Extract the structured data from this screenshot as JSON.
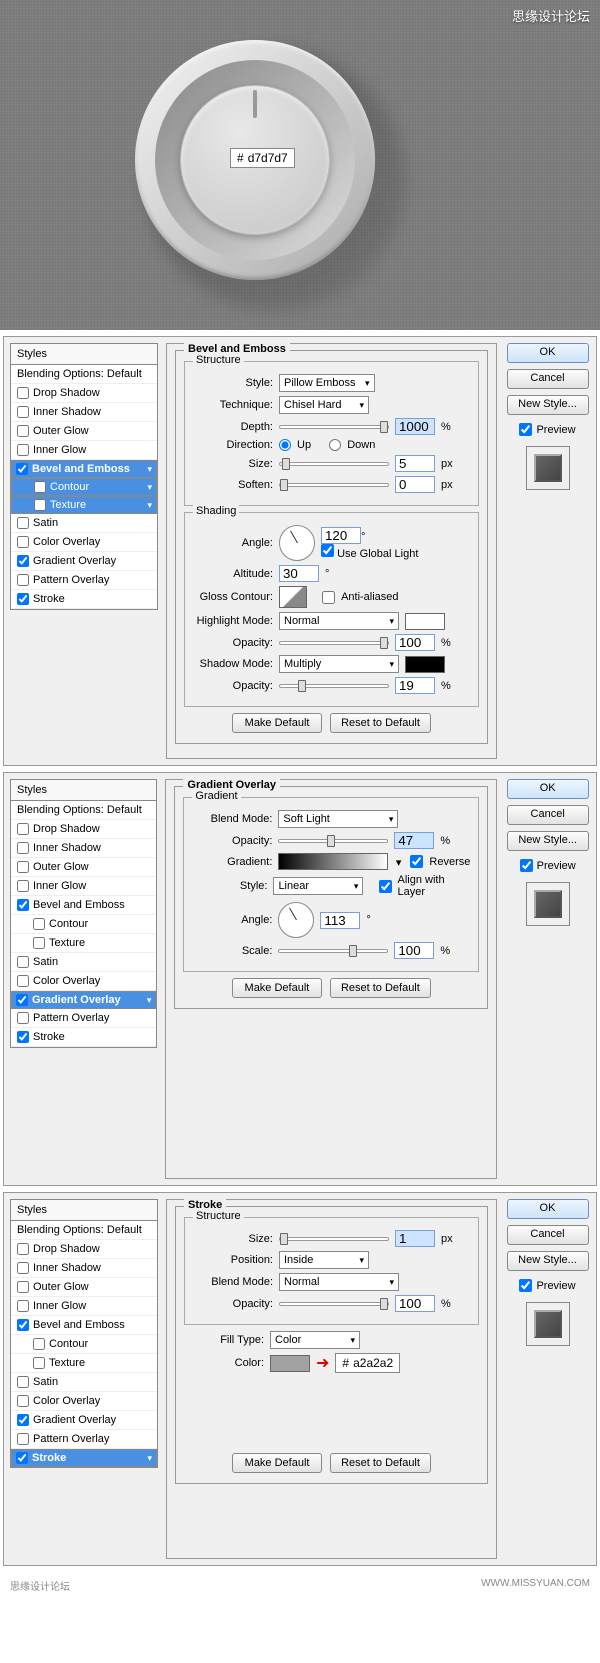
{
  "watermark_top": "思缘设计论坛",
  "hero_hex": "d7d7d7",
  "styles_header": "Styles",
  "blending_label": "Blending Options: Default",
  "common_style_items": [
    {
      "label": "Drop Shadow",
      "checked": false
    },
    {
      "label": "Inner Shadow",
      "checked": false
    },
    {
      "label": "Outer Glow",
      "checked": false
    },
    {
      "label": "Inner Glow",
      "checked": false
    },
    {
      "label": "Bevel and Emboss",
      "checked": true
    },
    {
      "label": "Contour",
      "checked": false,
      "indent": true
    },
    {
      "label": "Texture",
      "checked": false,
      "indent": true
    },
    {
      "label": "Satin",
      "checked": false
    },
    {
      "label": "Color Overlay",
      "checked": false
    },
    {
      "label": "Gradient Overlay",
      "checked": true
    },
    {
      "label": "Pattern Overlay",
      "checked": false
    },
    {
      "label": "Stroke",
      "checked": true
    }
  ],
  "buttons": {
    "ok": "OK",
    "cancel": "Cancel",
    "new_style": "New Style...",
    "preview": "Preview",
    "make_default": "Make Default",
    "reset_default": "Reset to Default"
  },
  "labels": {
    "style": "Style:",
    "technique": "Technique:",
    "depth": "Depth:",
    "direction": "Direction:",
    "size": "Size:",
    "soften": "Soften:",
    "angle": "Angle:",
    "altitude": "Altitude:",
    "gloss_contour": "Gloss Contour:",
    "anti_aliased": "Anti-aliased",
    "highlight_mode": "Highlight Mode:",
    "opacity": "Opacity:",
    "shadow_mode": "Shadow Mode:",
    "use_global": "Use Global Light",
    "blend_mode": "Blend Mode:",
    "gradient": "Gradient:",
    "reverse": "Reverse",
    "align_layer": "Align with Layer",
    "scale": "Scale:",
    "position": "Position:",
    "fill_type": "Fill Type:",
    "color": "Color:",
    "up": "Up",
    "down": "Down"
  },
  "units": {
    "pct": "%",
    "px": "px",
    "deg": "°"
  },
  "panel1": {
    "title": "Bevel and Emboss",
    "structure": "Structure",
    "shading": "Shading",
    "style": "Pillow Emboss",
    "technique": "Chisel Hard",
    "depth": "1000",
    "direction": "up",
    "size": "5",
    "soften": "0",
    "angle": "120",
    "altitude": "30",
    "highlight_mode": "Normal",
    "highlight_opacity": "100",
    "shadow_mode": "Multiply",
    "shadow_opacity": "19"
  },
  "panel2": {
    "title": "Gradient Overlay",
    "gradient": "Gradient",
    "blend_mode": "Soft Light",
    "opacity": "47",
    "reverse": true,
    "style": "Linear",
    "align": true,
    "angle": "113",
    "scale": "100"
  },
  "panel3": {
    "title": "Stroke",
    "structure": "Structure",
    "size": "1",
    "position": "Inside",
    "blend_mode": "Normal",
    "opacity": "100",
    "fill_type": "Color",
    "hex": "a2a2a2"
  },
  "footer_left": "思缘设计论坛",
  "footer_right": "WWW.MISSYUAN.COM"
}
